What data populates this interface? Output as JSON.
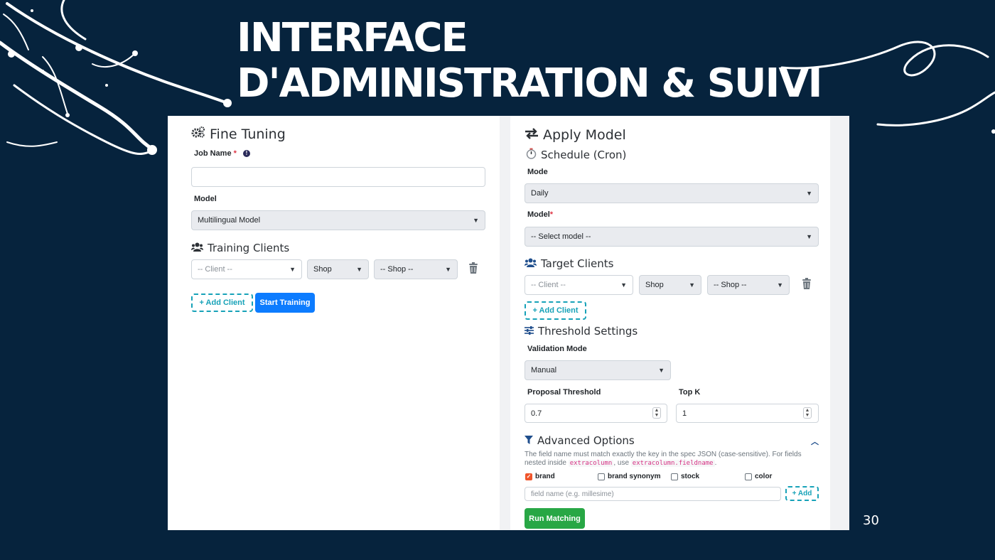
{
  "slide": {
    "title_line1": "INTERFACE",
    "title_line2": "D'ADMINISTRATION & SUIVI",
    "page_number": "30"
  },
  "fine_tuning": {
    "title": "Fine Tuning",
    "job_name_label": "Job Name",
    "required_mark": "*",
    "job_name_value": "",
    "model_label": "Model",
    "model_value": "Multilingual Model",
    "training_clients_title": "Training Clients",
    "client_placeholder": "-- Client --",
    "shop_value": "Shop",
    "shop_select_placeholder": "-- Shop --",
    "add_client_label": "+ Add Client",
    "start_training_label": "Start Training"
  },
  "apply_model": {
    "title": "Apply Model",
    "schedule_title": "Schedule (Cron)",
    "mode_label": "Mode",
    "mode_value": "Daily",
    "model_label": "Model",
    "required_mark": "*",
    "model_placeholder": "-- Select model --",
    "target_clients_title": "Target Clients",
    "client_placeholder": "-- Client --",
    "shop_value": "Shop",
    "shop_select_placeholder": "-- Shop --",
    "add_client_label": "+ Add Client",
    "threshold_title": "Threshold Settings",
    "validation_mode_label": "Validation Mode",
    "validation_mode_value": "Manual",
    "proposal_threshold_label": "Proposal Threshold",
    "proposal_threshold_value": "0.7",
    "top_k_label": "Top K",
    "top_k_value": "1",
    "advanced_title": "Advanced Options",
    "help_text_1": "The field name must match exactly the key in the spec JSON (case-sensitive). For fields nested inside",
    "help_code_1": "extracolumn",
    "help_text_2": ", use",
    "help_code_2": "extracolumn.fieldname",
    "help_text_3": ".",
    "fields": [
      {
        "label": "brand",
        "checked": true
      },
      {
        "label": "brand synonym",
        "checked": false
      },
      {
        "label": "stock",
        "checked": false
      },
      {
        "label": "color",
        "checked": false
      }
    ],
    "field_name_placeholder": "field name (e.g. millesime)",
    "add_field_label": "+ Add",
    "run_matching_label": "Run Matching"
  },
  "colors": {
    "background": "#06233d",
    "primary": "#0d7cff",
    "success": "#28a745",
    "info": "#17a2b8",
    "checkbox_checked": "#f0552b"
  }
}
